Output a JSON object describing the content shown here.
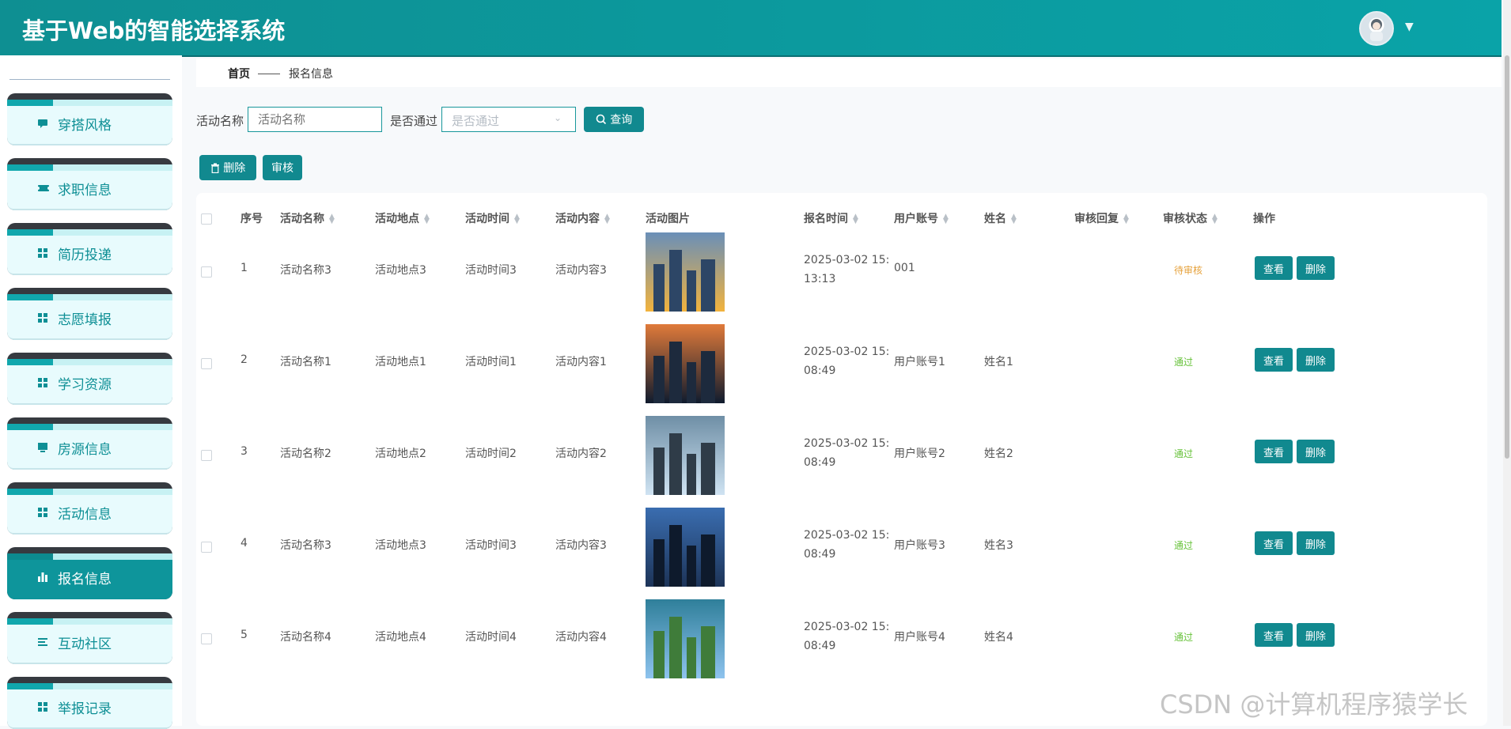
{
  "app": {
    "title": "基于Web的智能选择系统"
  },
  "header": {
    "user_caret": "▼"
  },
  "sidebar": {
    "items": [
      {
        "label": "穿搭风格",
        "icon": "chat-icon",
        "active": false
      },
      {
        "label": "求职信息",
        "icon": "ticket-icon",
        "active": false
      },
      {
        "label": "简历投递",
        "icon": "grid-icon",
        "active": false
      },
      {
        "label": "志愿填报",
        "icon": "grid-icon",
        "active": false
      },
      {
        "label": "学习资源",
        "icon": "grid-icon",
        "active": false
      },
      {
        "label": "房源信息",
        "icon": "monitor-icon",
        "active": false
      },
      {
        "label": "活动信息",
        "icon": "grid-icon",
        "active": false
      },
      {
        "label": "报名信息",
        "icon": "bar-chart-icon",
        "active": true
      },
      {
        "label": "互动社区",
        "icon": "list-icon",
        "active": false
      },
      {
        "label": "举报记录",
        "icon": "grid-icon",
        "active": false
      }
    ]
  },
  "breadcrumb": {
    "home": "首页",
    "current": "报名信息"
  },
  "filters": {
    "name_label": "活动名称",
    "name_placeholder": "活动名称",
    "pass_label": "是否通过",
    "pass_placeholder": "是否通过",
    "search_button": "查询"
  },
  "toolbar": {
    "delete_button": "删除",
    "review_button": "审核"
  },
  "table": {
    "columns": [
      "序号",
      "活动名称",
      "活动地点",
      "活动时间",
      "活动内容",
      "活动图片",
      "报名时间",
      "用户账号",
      "姓名",
      "审核回复",
      "审核状态",
      "操作"
    ],
    "rows": [
      {
        "index": "1",
        "name": "活动名称3",
        "place": "活动地点3",
        "time": "活动时间3",
        "content": "活动内容3",
        "signup_time_line1": "2025-03-02 15:",
        "signup_time_line2": "13:13",
        "account": "001",
        "person": "",
        "reply": "",
        "status": "待审核",
        "status_type": "pending",
        "view": "查看",
        "delete": "删除"
      },
      {
        "index": "2",
        "name": "活动名称1",
        "place": "活动地点1",
        "time": "活动时间1",
        "content": "活动内容1",
        "signup_time_line1": "2025-03-02 15:",
        "signup_time_line2": "08:49",
        "account": "用户账号1",
        "person": "姓名1",
        "reply": "",
        "status": "通过",
        "status_type": "ok",
        "view": "查看",
        "delete": "删除"
      },
      {
        "index": "3",
        "name": "活动名称2",
        "place": "活动地点2",
        "time": "活动时间2",
        "content": "活动内容2",
        "signup_time_line1": "2025-03-02 15:",
        "signup_time_line2": "08:49",
        "account": "用户账号2",
        "person": "姓名2",
        "reply": "",
        "status": "通过",
        "status_type": "ok",
        "view": "查看",
        "delete": "删除"
      },
      {
        "index": "4",
        "name": "活动名称3",
        "place": "活动地点3",
        "time": "活动时间3",
        "content": "活动内容3",
        "signup_time_line1": "2025-03-02 15:",
        "signup_time_line2": "08:49",
        "account": "用户账号3",
        "person": "姓名3",
        "reply": "",
        "status": "通过",
        "status_type": "ok",
        "view": "查看",
        "delete": "删除"
      },
      {
        "index": "5",
        "name": "活动名称4",
        "place": "活动地点4",
        "time": "活动时间4",
        "content": "活动内容4",
        "signup_time_line1": "2025-03-02 15:",
        "signup_time_line2": "08:49",
        "account": "用户账号4",
        "person": "姓名4",
        "reply": "",
        "status": "通过",
        "status_type": "ok",
        "view": "查看",
        "delete": "删除"
      }
    ]
  },
  "watermark": "CSDN @计算机程序猿学长",
  "colors": {
    "primary": "#11898f",
    "header": "#0aa3a8",
    "pending": "#e6a23c",
    "ok": "#67c23a"
  }
}
